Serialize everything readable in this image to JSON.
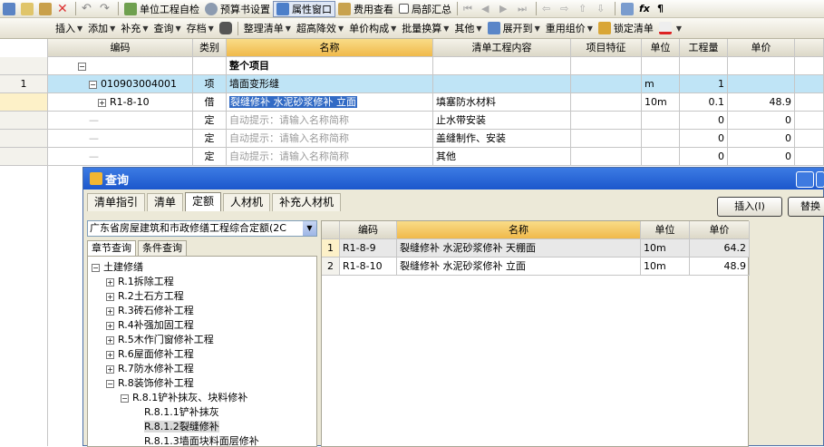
{
  "toolbar1": {
    "items": [
      {
        "label": "单位工程自检",
        "icon": "check-icon"
      },
      {
        "label": "预算书设置",
        "icon": "gear-icon"
      },
      {
        "label": "属性窗口",
        "icon": "window-icon",
        "pressed": true
      },
      {
        "label": "费用查看",
        "icon": "fee-icon"
      },
      {
        "label": "局部汇总",
        "icon": "checkbox-icon"
      }
    ]
  },
  "toolbar2": {
    "close": "✕",
    "items": [
      "插入",
      "添加",
      "补充",
      "查询",
      "存档",
      "整理清单",
      "超高降效",
      "单价构成",
      "批量换算",
      "其他",
      "展开到",
      "重用组价",
      "锁定清单"
    ]
  },
  "grid": {
    "columns": [
      "编码",
      "类别",
      "名称",
      "清单工程内容",
      "项目特征",
      "单位",
      "工程量",
      "单价"
    ],
    "rows": [
      {
        "rownum": "",
        "code": "",
        "toggle": "−",
        "type": "",
        "name": "整个项目",
        "content": "",
        "feature": "",
        "unit": "",
        "qty": "",
        "price": ""
      },
      {
        "rownum": "1",
        "code": "010903004001",
        "toggle": "−",
        "type": "项",
        "name": "墙面变形缝",
        "content": "",
        "feature": "",
        "unit": "m",
        "qty": "1",
        "price": ""
      },
      {
        "rownum": "",
        "code": "R1-8-10",
        "toggle": "+",
        "type": "借",
        "name": "裂缝修补 水泥砂浆修补 立面",
        "content": "填塞防水材料",
        "feature": "",
        "unit": "10m",
        "qty": "0.1",
        "price": "48.9"
      },
      {
        "rownum": "",
        "code": "—",
        "toggle": "",
        "type": "定",
        "name": "自动提示：请输入名称简称",
        "content": "止水带安装",
        "feature": "",
        "unit": "",
        "qty": "0",
        "price": "0"
      },
      {
        "rownum": "",
        "code": "—",
        "toggle": "",
        "type": "定",
        "name": "自动提示：请输入名称简称",
        "content": "盖缝制作、安装",
        "feature": "",
        "unit": "",
        "qty": "0",
        "price": "0"
      },
      {
        "rownum": "",
        "code": "—",
        "toggle": "",
        "type": "定",
        "name": "自动提示：请输入名称简称",
        "content": "其他",
        "feature": "",
        "unit": "",
        "qty": "0",
        "price": "0"
      }
    ]
  },
  "dialog": {
    "title": "查询",
    "tabs": [
      "清单指引",
      "清单",
      "定额",
      "人材机",
      "补充人材机"
    ],
    "active_tab": 2,
    "insert_button": "插入(I)",
    "replace_button": "替换",
    "library": "广东省房屋建筑和市政修缮工程综合定额(2C",
    "subtabs": [
      "章节查询",
      "条件查询"
    ],
    "tree": [
      {
        "label": "土建修缮",
        "level": 0,
        "toggle": "−"
      },
      {
        "label": "R.1拆除工程",
        "level": 1,
        "toggle": "+"
      },
      {
        "label": "R.2土石方工程",
        "level": 1,
        "toggle": "+"
      },
      {
        "label": "R.3砖石修补工程",
        "level": 1,
        "toggle": "+"
      },
      {
        "label": "R.4补强加固工程",
        "level": 1,
        "toggle": "+"
      },
      {
        "label": "R.5木作门窗修补工程",
        "level": 1,
        "toggle": "+"
      },
      {
        "label": "R.6屋面修补工程",
        "level": 1,
        "toggle": "+"
      },
      {
        "label": "R.7防水修补工程",
        "level": 1,
        "toggle": "+"
      },
      {
        "label": "R.8装饰修补工程",
        "level": 1,
        "toggle": "−"
      },
      {
        "label": "R.8.1铲补抹灰、块料修补",
        "level": 2,
        "toggle": "−"
      },
      {
        "label": "R.8.1.1铲补抹灰",
        "level": 3,
        "toggle": ""
      },
      {
        "label": "R.8.1.2裂缝修补",
        "level": 3,
        "toggle": "",
        "selected": true
      },
      {
        "label": "R.8.1.3墙面块料面层修补",
        "level": 3,
        "toggle": ""
      }
    ],
    "result_columns": [
      "编码",
      "名称",
      "单位",
      "单价"
    ],
    "results": [
      {
        "n": "1",
        "code": "R1-8-9",
        "name": "裂缝修补 水泥砂浆修补 天棚面",
        "unit": "10m",
        "price": "64.2"
      },
      {
        "n": "2",
        "code": "R1-8-10",
        "name": "裂缝修补 水泥砂浆修补 立面",
        "unit": "10m",
        "price": "48.9"
      }
    ]
  },
  "colors": {
    "accent": "#1c57cc",
    "header_highlight": "#f0b94a",
    "row_selected": "#bfe4f6"
  }
}
